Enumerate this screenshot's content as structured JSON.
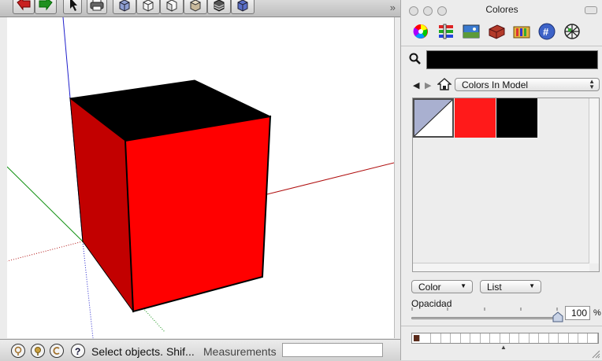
{
  "status_bar": {
    "hint": "Select objects. Shif...",
    "measurements_label": "Measurements",
    "measurements_value": ""
  },
  "colors_panel": {
    "title": "Colores",
    "search_value": "",
    "library_select": "Colors In Model",
    "swatches": [
      "default-material",
      "#ff1a1a",
      "#000000"
    ],
    "color_popup": "Color",
    "view_popup": "List",
    "opacity_label": "Opacidad",
    "opacity_value": "100",
    "opacity_unit": "%"
  },
  "colors": {
    "cube_front": "#ff0000",
    "cube_left": "#c20000",
    "cube_top": "#000000",
    "axis_blue": "#2020cc",
    "axis_red": "#b01010",
    "axis_green": "#109010"
  },
  "icons": [
    "select-arrow-icon",
    "print-icon",
    "iso-view-icon",
    "top-view-icon",
    "front-view-icon",
    "right-view-icon",
    "back-view-icon",
    "left-view-icon",
    "color-wheel-icon",
    "color-sliders-icon",
    "image-palette-icon",
    "brick-icon",
    "crayons-icon",
    "hash-icon",
    "globe-icon",
    "magnifier-icon",
    "home-icon"
  ]
}
